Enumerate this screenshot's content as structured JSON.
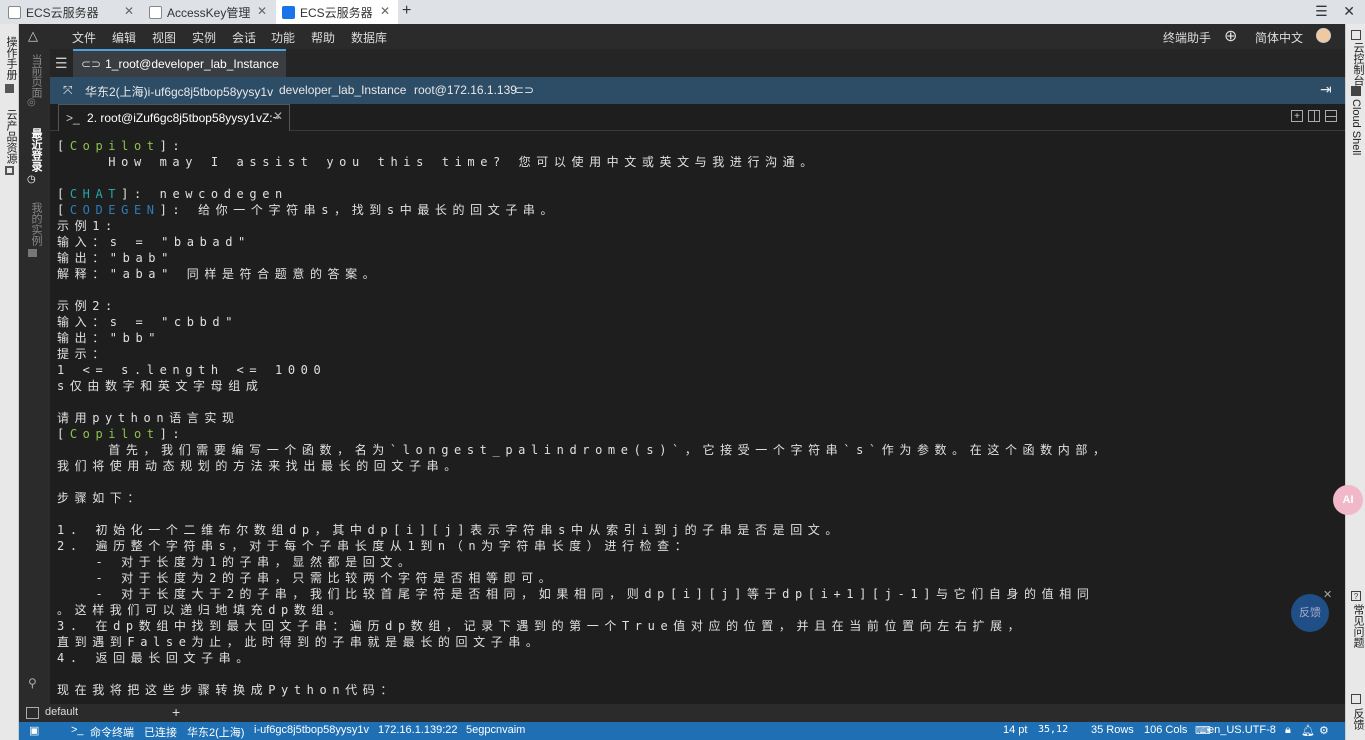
{
  "browser": {
    "tabs": [
      {
        "title": "ECS云服务器",
        "active": false
      },
      {
        "title": "AccessKey管理",
        "active": false
      },
      {
        "title": "ECS云服务器",
        "active": true
      }
    ],
    "new_tab": "+"
  },
  "left_strip": {
    "items": [
      "操作手册",
      "云产品资源"
    ]
  },
  "sidebar": {
    "items": [
      {
        "label": "当前页面",
        "active": false
      },
      {
        "label": "最近登录",
        "active": true
      },
      {
        "label": "我的实例",
        "active": false
      }
    ]
  },
  "right_strip": {
    "items": [
      "云控制台",
      "Cloud Shell",
      "常见问题",
      "反馈"
    ]
  },
  "menu": {
    "items": [
      "文件",
      "编辑",
      "视图",
      "实例",
      "会话",
      "功能",
      "帮助",
      "数据库"
    ],
    "assistant": "终端助手",
    "language": "简体中文"
  },
  "session_tab": {
    "label": "1_root@developer_lab_Instance"
  },
  "info": {
    "region_instance": "华东2(上海)i-uf6gc8j5tbop58yysy1v",
    "instance_name": "developer_lab_Instance",
    "host": "root@172.16.1.139"
  },
  "sub_tab": {
    "label": "2. root@iZuf6gc8j5tbop58yysy1vZ:~"
  },
  "terminal": {
    "lines": [
      {
        "parts": [
          {
            "t": "[",
            "c": ""
          },
          {
            "t": "Copilot",
            "c": "g"
          },
          {
            "t": "]:",
            "c": ""
          }
        ]
      },
      {
        "parts": [
          {
            "t": "    How may I assist you this time? 您可以使用中文或英文与我进行沟通。",
            "c": ""
          }
        ]
      },
      {
        "parts": [
          {
            "t": "",
            "c": ""
          }
        ]
      },
      {
        "parts": [
          {
            "t": "[",
            "c": ""
          },
          {
            "t": "CHAT",
            "c": "c"
          },
          {
            "t": "]: newcodegen",
            "c": ""
          }
        ]
      },
      {
        "parts": [
          {
            "t": "[",
            "c": ""
          },
          {
            "t": "CODEGEN",
            "c": "b"
          },
          {
            "t": "]: 给你一个字符串s，找到s中最长的回文子串。",
            "c": ""
          }
        ]
      },
      {
        "parts": [
          {
            "t": "示例1:",
            "c": ""
          }
        ]
      },
      {
        "parts": [
          {
            "t": "输入：s = \"babad\"",
            "c": ""
          }
        ]
      },
      {
        "parts": [
          {
            "t": "输出：\"bab\"",
            "c": ""
          }
        ]
      },
      {
        "parts": [
          {
            "t": "解释：\"aba\" 同样是符合题意的答案。",
            "c": ""
          }
        ]
      },
      {
        "parts": [
          {
            "t": "",
            "c": ""
          }
        ]
      },
      {
        "parts": [
          {
            "t": "示例2:",
            "c": ""
          }
        ]
      },
      {
        "parts": [
          {
            "t": "输入：s = \"cbbd\"",
            "c": ""
          }
        ]
      },
      {
        "parts": [
          {
            "t": "输出：\"bb\"",
            "c": ""
          }
        ]
      },
      {
        "parts": [
          {
            "t": "提示：",
            "c": ""
          }
        ]
      },
      {
        "parts": [
          {
            "t": "1 <= s.length <= 1000",
            "c": ""
          }
        ]
      },
      {
        "parts": [
          {
            "t": "s仅由数字和英文字母组成",
            "c": ""
          }
        ]
      },
      {
        "parts": [
          {
            "t": "",
            "c": ""
          }
        ]
      },
      {
        "parts": [
          {
            "t": "请用python语言实现",
            "c": ""
          }
        ]
      },
      {
        "parts": [
          {
            "t": "[",
            "c": ""
          },
          {
            "t": "Copilot",
            "c": "g"
          },
          {
            "t": "]:",
            "c": ""
          }
        ]
      },
      {
        "parts": [
          {
            "t": "    首先，我们需要编写一个函数，名为`longest_palindrome(s)`，它接受一个字符串`s`作为参数。在这个函数内部，",
            "c": ""
          }
        ]
      },
      {
        "parts": [
          {
            "t": "我们将使用动态规划的方法来找出最长的回文子串。",
            "c": ""
          }
        ]
      },
      {
        "parts": [
          {
            "t": "",
            "c": ""
          }
        ]
      },
      {
        "parts": [
          {
            "t": "步骤如下：",
            "c": ""
          }
        ]
      },
      {
        "parts": [
          {
            "t": "",
            "c": ""
          }
        ]
      },
      {
        "parts": [
          {
            "t": "1. 初始化一个二维布尔数组dp，其中dp[i][j]表示字符串s中从索引i到j的子串是否是回文。",
            "c": ""
          }
        ]
      },
      {
        "parts": [
          {
            "t": "2. 遍历整个字符串s，对于每个子串长度从1到n（n为字符串长度）进行检查：",
            "c": ""
          }
        ]
      },
      {
        "parts": [
          {
            "t": "   - 对于长度为1的子串，显然都是回文。",
            "c": ""
          }
        ]
      },
      {
        "parts": [
          {
            "t": "   - 对于长度为2的子串，只需比较两个字符是否相等即可。",
            "c": ""
          }
        ]
      },
      {
        "parts": [
          {
            "t": "   - 对于长度大于2的子串，我们比较首尾字符是否相同，如果相同，则dp[i][j]等于dp[i+1][j-1]与它们自身的值相同",
            "c": ""
          }
        ]
      },
      {
        "parts": [
          {
            "t": "。这样我们可以递归地填充dp数组。",
            "c": ""
          }
        ]
      },
      {
        "parts": [
          {
            "t": "3. 在dp数组中找到最大回文子串：遍历dp数组，记录下遇到的第一个True值对应的位置，并且在当前位置向左右扩展，",
            "c": ""
          }
        ]
      },
      {
        "parts": [
          {
            "t": "直到遇到False为止，此时得到的子串就是最长的回文子串。",
            "c": ""
          }
        ]
      },
      {
        "parts": [
          {
            "t": "4. 返回最长回文子串。",
            "c": ""
          }
        ]
      },
      {
        "parts": [
          {
            "t": "",
            "c": ""
          }
        ]
      },
      {
        "parts": [
          {
            "t": "现在我将把这些步骤转换成Python代码：",
            "c": ""
          }
        ]
      }
    ]
  },
  "bottom_tabs": {
    "default_label": "default",
    "add": "+"
  },
  "status": {
    "command_terminal": "命令终端",
    "connected": "已连接",
    "region": "华东2(上海)",
    "instance_id": "i-uf6gc8j5tbop58yysy1v",
    "ip_port": "172.16.1.139:22",
    "session": "5egpcnvaim",
    "font_size": "14 pt",
    "cursor": "35,12",
    "rows": "35 Rows",
    "cols": "106 Cols",
    "encoding": "en_US.UTF-8"
  },
  "floating": {
    "feedback": "反馈",
    "ai": "AI"
  }
}
